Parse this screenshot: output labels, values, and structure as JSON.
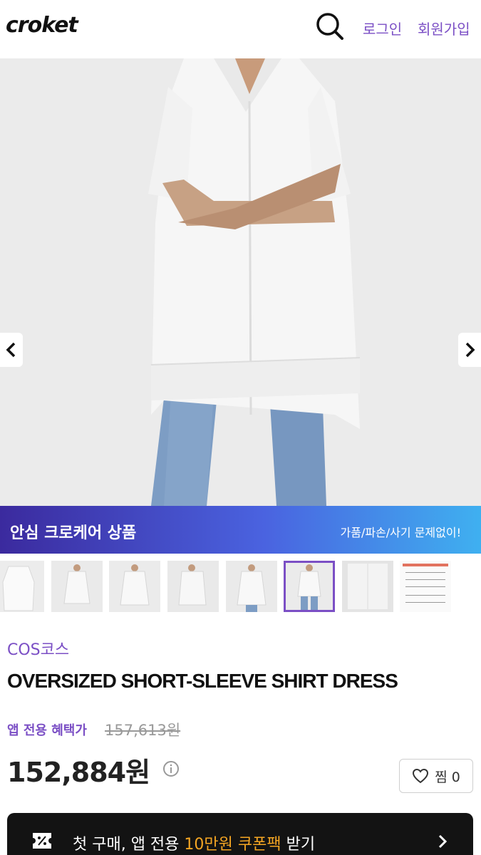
{
  "header": {
    "logo": "croket",
    "login": "로그인",
    "signup": "회원가입",
    "search_icon": "search-icon"
  },
  "gallery": {
    "prev_icon": "chevron-left-icon",
    "next_icon": "chevron-right-icon",
    "thumbnail_count": 8,
    "selected_thumbnail": 5
  },
  "banner": {
    "title": "안심 크로케어 상품",
    "subtitle": "가품/파손/사기 문제없이!"
  },
  "product": {
    "brand": "COS코스",
    "name": "OVERSIZED SHORT-SLEEVE SHIRT DRESS",
    "app_benefit_label": "앱 전용 혜택가",
    "original_price": "157,613원",
    "price": "152,884원",
    "wish_label": "찜 0"
  },
  "coupon": {
    "text_prefix": "첫 구매, 앱 전용 ",
    "text_highlight": "10만원 쿠폰팩",
    "text_suffix": " 받기",
    "icon": "discount-ticket-icon"
  },
  "colors": {
    "accent": "#7b4fc5",
    "banner_start": "#3b2a9e",
    "banner_end": "#3fb0f0",
    "coupon_bg": "#131313",
    "coupon_highlight": "#f5a623"
  }
}
